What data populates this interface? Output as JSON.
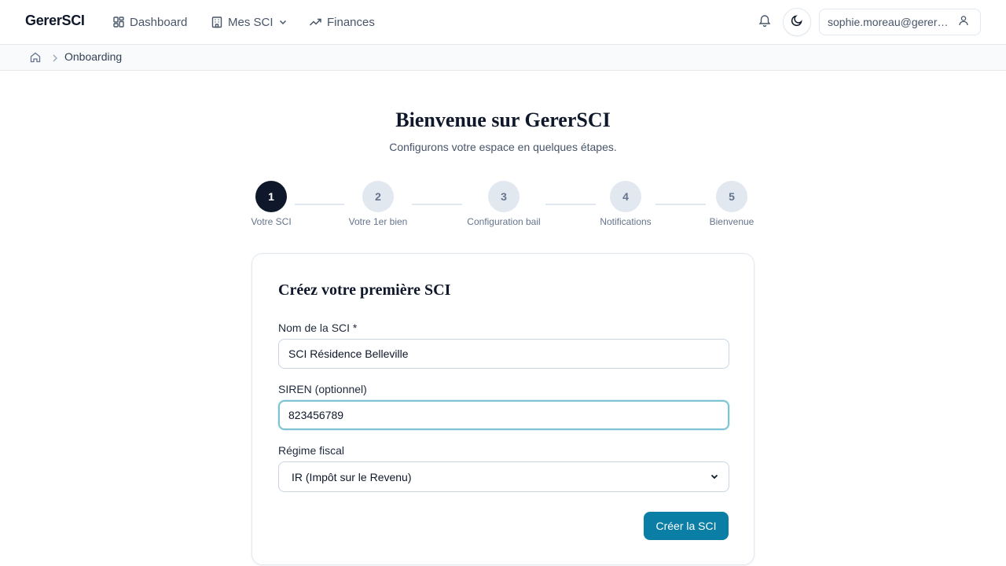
{
  "app": {
    "brand": "GererSCI"
  },
  "nav": {
    "items": [
      {
        "label": "Dashboard",
        "icon": "grid-icon"
      },
      {
        "label": "Mes SCI",
        "icon": "building-icon"
      },
      {
        "label": "Finances",
        "icon": "trending-up-icon"
      }
    ]
  },
  "header": {
    "user_email": "sophie.moreau@gerersci.fr"
  },
  "breadcrumb": {
    "current": "Onboarding"
  },
  "welcome": {
    "title": "Bienvenue sur GererSCI",
    "subtitle": "Configurons votre espace en quelques étapes."
  },
  "stepper": {
    "active_step": 1,
    "steps": [
      {
        "number": "1",
        "label": "Votre SCI"
      },
      {
        "number": "2",
        "label": "Votre 1er bien"
      },
      {
        "number": "3",
        "label": "Configuration bail"
      },
      {
        "number": "4",
        "label": "Notifications"
      },
      {
        "number": "5",
        "label": "Bienvenue"
      }
    ]
  },
  "form": {
    "title": "Créez votre première SCI",
    "name_label": "Nom de la SCI *",
    "name_value": "SCI Résidence Belleville",
    "siren_label": "SIREN (optionnel)",
    "siren_value": "823456789",
    "regime_label": "Régime fiscal",
    "regime_value": "IR (Impôt sur le Revenu)",
    "submit_label": "Créer la SCI"
  },
  "colors": {
    "primary": "#0a7ea4",
    "step_active": "#0f172a",
    "step_idle": "#e2e8f0",
    "focus_ring": "#7dc3d3"
  }
}
